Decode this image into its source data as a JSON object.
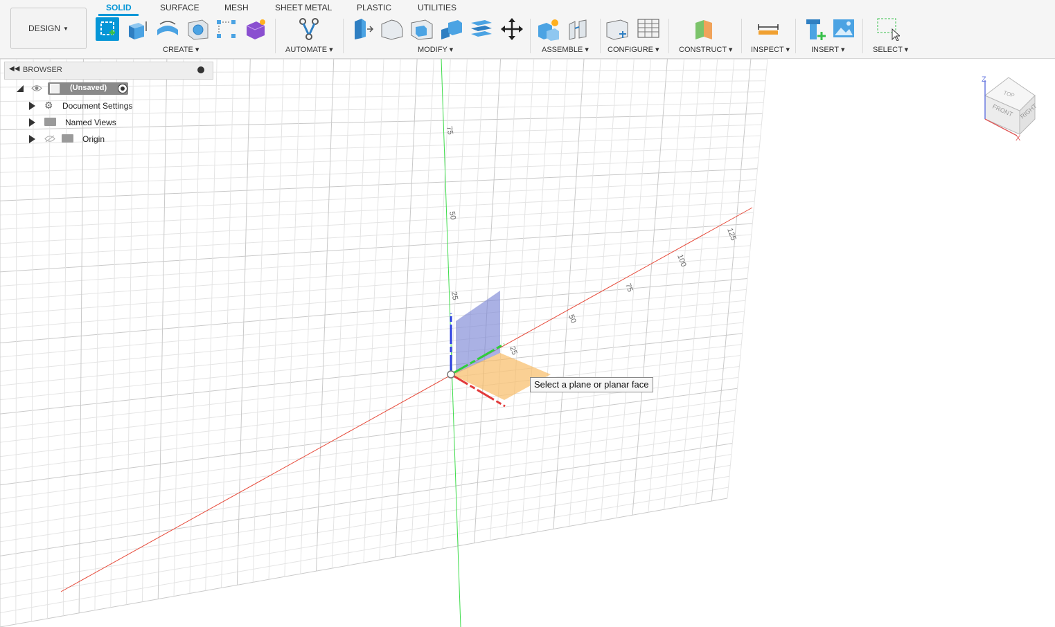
{
  "workspace": {
    "label": "DESIGN"
  },
  "tabs": [
    {
      "label": "SOLID",
      "active": true
    },
    {
      "label": "SURFACE",
      "active": false
    },
    {
      "label": "MESH",
      "active": false
    },
    {
      "label": "SHEET METAL",
      "active": false
    },
    {
      "label": "PLASTIC",
      "active": false
    },
    {
      "label": "UTILITIES",
      "active": false
    }
  ],
  "groups": {
    "create": "CREATE",
    "automate": "AUTOMATE",
    "modify": "MODIFY",
    "assemble": "ASSEMBLE",
    "configure": "CONFIGURE",
    "construct": "CONSTRUCT",
    "inspect": "INSPECT",
    "insert": "INSERT",
    "select": "SELECT"
  },
  "tools": {
    "create": [
      "create-sketch-icon",
      "extrude-icon",
      "revolve-icon",
      "hole-icon",
      "pattern-icon",
      "create-form-icon"
    ],
    "automate": [
      "automate-icon"
    ],
    "modify": [
      "press-pull-icon",
      "fillet-icon",
      "shell-icon",
      "combine-icon",
      "offset-face-icon",
      "move-icon"
    ],
    "assemble": [
      "new-component-icon",
      "joint-icon"
    ],
    "configure": [
      "configure-icon",
      "table-icon"
    ],
    "construct": [
      "offset-plane-icon"
    ],
    "inspect": [
      "measure-icon"
    ],
    "insert": [
      "insert-derive-icon",
      "insert-image-icon"
    ],
    "select": [
      "select-window-icon"
    ]
  },
  "browser": {
    "title": "BROWSER",
    "root": "(Unsaved)",
    "items": [
      {
        "label": "Document Settings",
        "icon": "gear-icon"
      },
      {
        "label": "Named Views",
        "icon": "folder-icon"
      },
      {
        "label": "Origin",
        "icon": "folder-icon"
      }
    ]
  },
  "viewport": {
    "tooltip": "Select a plane or planar face",
    "vertical_axis_labels": [
      "75",
      "50",
      "25"
    ],
    "horizontal_axis_labels": [
      "25",
      "50",
      "75",
      "100",
      "125"
    ]
  },
  "viewcube": {
    "top": "TOP",
    "front": "FRONT",
    "right": "RIGHT",
    "z": "Z",
    "x": "X"
  },
  "colors": {
    "accent": "#0696d7",
    "x_axis": "#e23b3b",
    "y_axis": "#2fcf3b",
    "z_axis": "#2b3fe0",
    "xy_plane": "#f7b75a",
    "yz_plane": "#7d87d6"
  }
}
